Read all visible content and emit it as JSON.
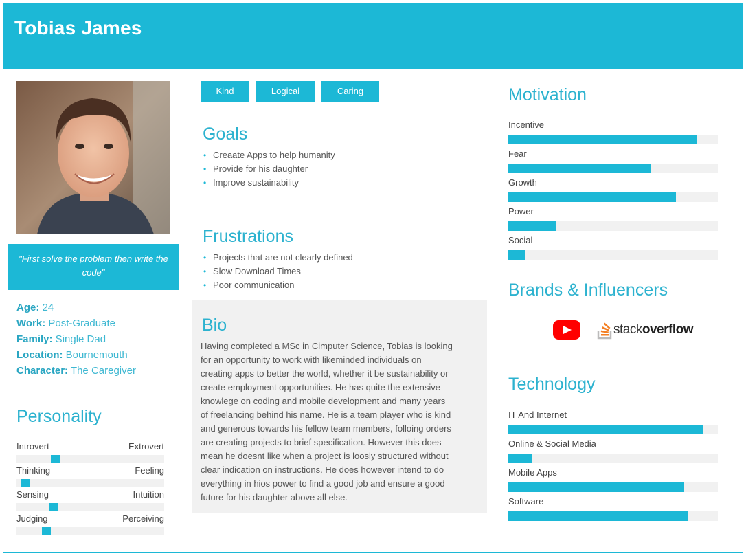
{
  "persona": {
    "name": "Tobias James",
    "quote": "\"First solve the problem then write the code\"",
    "facts": [
      {
        "key": "Age:",
        "value": " 24"
      },
      {
        "key": "Work:",
        "value": " Post-Graduate"
      },
      {
        "key": "Family:",
        "value": " Single Dad"
      },
      {
        "key": "Location:",
        "value": " Bournemouth"
      },
      {
        "key": "Character:",
        "value": " The Caregiver"
      }
    ]
  },
  "personality": {
    "title": "Personality",
    "scales": [
      {
        "left": "Introvert",
        "right": "Extrovert",
        "level": 0.26
      },
      {
        "left": "Thinking",
        "right": "Feeling",
        "level": 0.06
      },
      {
        "left": "Sensing",
        "right": "Intuition",
        "level": 0.25
      },
      {
        "left": "Judging",
        "right": "Perceiving",
        "level": 0.2
      }
    ]
  },
  "tags": [
    "Kind",
    "Logical",
    "Caring"
  ],
  "goals": {
    "title": "Goals",
    "items": [
      "Creaate Apps to help humanity",
      "Provide for his daughter",
      "Improve sustainability"
    ]
  },
  "frustrations": {
    "title": "Frustrations",
    "items": [
      "Projects that are not clearly defined",
      "Slow Download Times",
      "Poor communication"
    ]
  },
  "bio": {
    "title": "Bio",
    "lines": [
      "Having completed a MSc in Cimputer Science, Tobias is looking",
      "for an opportunity to work with likeminded individuals on",
      "creating apps to better the world, whether it be sustainability or",
      "create employment opportunities. He has quite the extensive",
      "knowlege on coding and mobile development and many years",
      "of freelancing behind his name. He is a team player who is kind",
      "and generous towards his fellow team members, folloing orders",
      "are creating projects to brief specification. However this does",
      "mean he doesnt like when a project is loosly structured without",
      "clear indication on instructions. He does however intend to do",
      "everything in hios power to find a good job and ensure a good",
      "future for his daughter above all else."
    ]
  },
  "motivation": {
    "title": "Motivation",
    "items": [
      {
        "label": "Incentive",
        "level": 0.9
      },
      {
        "label": "Fear",
        "level": 0.68
      },
      {
        "label": "Growth",
        "level": 0.8
      },
      {
        "label": "Power",
        "level": 0.23
      },
      {
        "label": "Social",
        "level": 0.08
      }
    ]
  },
  "brands": {
    "title": "Brands & Influencers",
    "logos": [
      "youtube",
      "stack overflow"
    ],
    "so_prefix": "stack",
    "so_suffix": "overflow"
  },
  "technology": {
    "title": "Technology",
    "items": [
      {
        "label": "IT And Internet",
        "level": 0.93
      },
      {
        "label": "Online & Social Media",
        "level": 0.11
      },
      {
        "label": "Mobile Apps",
        "level": 0.84
      },
      {
        "label": "Software",
        "level": 0.86
      }
    ]
  },
  "colors": {
    "accent": "#1cb8d6",
    "track": "#f1f1f1",
    "youtube": "#ff0000",
    "stackoverflow": "#f48024"
  }
}
